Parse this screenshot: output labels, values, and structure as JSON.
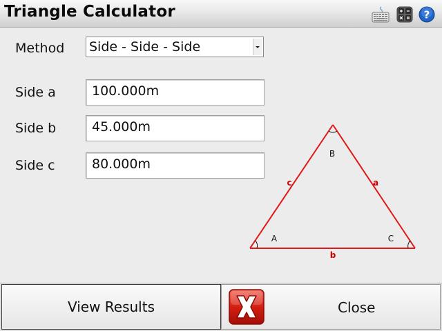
{
  "window": {
    "title": "Triangle Calculator"
  },
  "toolbar": {
    "icons": [
      "keyboard-icon",
      "calculator-icon",
      "help-icon"
    ],
    "help_glyph": "?"
  },
  "form": {
    "method": {
      "label": "Method",
      "value": "Side - Side - Side"
    },
    "side_a": {
      "label": "Side a",
      "value": "100.000m"
    },
    "side_b": {
      "label": "Side b",
      "value": "45.000m"
    },
    "side_c": {
      "label": "Side c",
      "value": "80.000m"
    }
  },
  "diagram": {
    "vertex_labels": {
      "A": "A",
      "B": "B",
      "C": "C"
    },
    "side_labels": {
      "a": "a",
      "b": "b",
      "c": "c"
    },
    "colors": {
      "edges": "#e01818",
      "labels": "#cc0000",
      "arcs": "#111111"
    }
  },
  "actions": {
    "view_results": "View Results",
    "close": "Close"
  }
}
